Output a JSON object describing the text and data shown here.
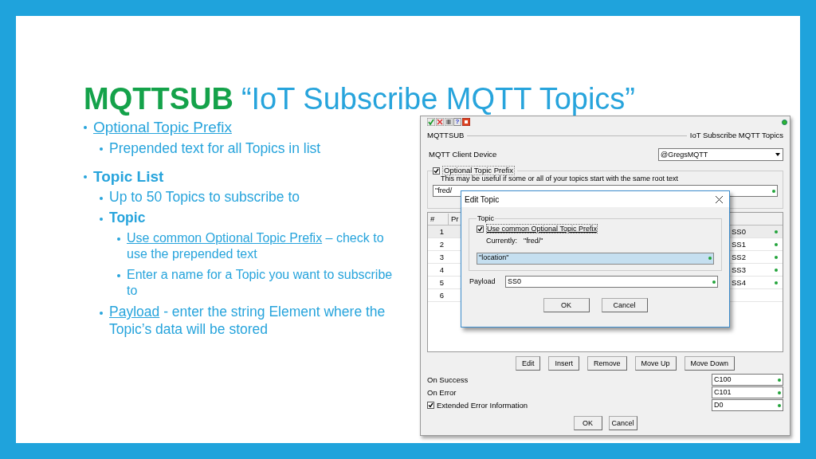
{
  "slide": {
    "title_code": "MQTTSUB",
    "title_text": "“IoT Subscribe MQTT Topics”"
  },
  "bullets": [
    {
      "link": "Optional Topic Prefix",
      "children": [
        {
          "text": "Prepended text for all Topics in list"
        }
      ]
    },
    {
      "text": "Topic List",
      "bold": true,
      "children": [
        {
          "text": "Up to 50 Topics to subscribe to"
        },
        {
          "text": "Topic",
          "bold": true,
          "children": [
            {
              "link": "Use common Optional Topic Prefix",
              "text": "– check to use the prepended text"
            },
            {
              "text": "Enter a name for a Topic you want to subscribe to"
            }
          ]
        },
        {
          "link": "Payload",
          "text": "- enter the string Element where the Topic’s data will be stored"
        }
      ]
    }
  ],
  "dialog": {
    "toolbar": [
      {
        "kind": "accept"
      },
      {
        "kind": "cancel"
      },
      {
        "kind": "grid"
      },
      {
        "kind": "help",
        "label": "?"
      },
      {
        "kind": "stop"
      }
    ],
    "name": "MQTTSUB",
    "description": "IoT Subscribe MQTT Topics",
    "device_label": "MQTT Client Device",
    "device_value": "@GregsMQTT",
    "prefix": {
      "label": "Optional Topic Prefix",
      "checked": true,
      "hint": "This may be useful if some or all of your topics start with the same root text",
      "value": "\"fred/"
    },
    "table": {
      "columns": [
        "#",
        "Pr"
      ],
      "rows": [
        {
          "number": "1",
          "column_3": "SS0",
          "selected": true
        },
        {
          "number": "2",
          "column_3": "SS1",
          "selected": false
        },
        {
          "number": "3",
          "column_3": "SS2",
          "selected": false
        },
        {
          "number": "4",
          "column_3": "SS3",
          "selected": false
        },
        {
          "number": "5",
          "column_3": "SS4",
          "selected": false
        },
        {
          "number": "6",
          "selected": false
        }
      ]
    },
    "list_buttons": [
      "Edit",
      "Insert",
      "Remove",
      "Move Up",
      "Move Down"
    ],
    "on_success": {
      "label": "On Success",
      "value": "C100"
    },
    "on_error": {
      "label": "On Error",
      "value": "C101"
    },
    "extended_error": {
      "label": "Extended Error Information",
      "checked": true,
      "value": "D0"
    },
    "buttons": [
      "OK",
      "Cancel"
    ]
  },
  "edit_topic": {
    "title": "Edit Topic",
    "group": "Topic",
    "use_prefix": {
      "label": "Use common Optional Topic Prefix",
      "checked": true
    },
    "currently_label": "Currently:",
    "currently_value": "\"fred/\"",
    "topic_value": "\"location\"",
    "payload_label": "Payload",
    "payload_value": "SS0",
    "buttons": [
      "OK",
      "Cancel"
    ]
  }
}
